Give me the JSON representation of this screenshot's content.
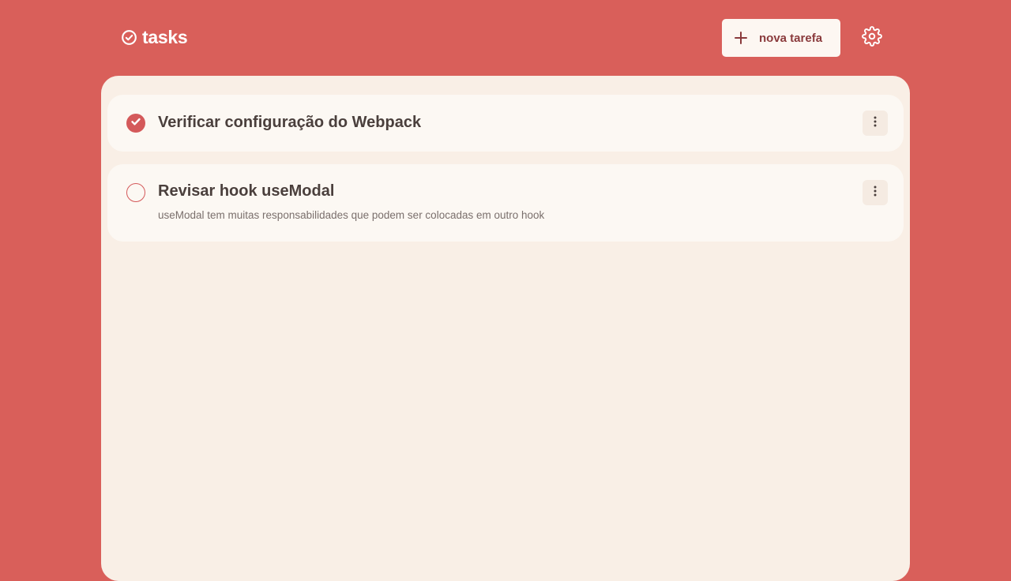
{
  "header": {
    "logo_text": "tasks",
    "new_task_label": "nova tarefa"
  },
  "colors": {
    "background": "#d95f5a",
    "panel": "#f9efe6",
    "card": "#fcf8f3",
    "accent": "#d4595a"
  },
  "tasks": [
    {
      "title": "Verificar configuração do Webpack",
      "description": "",
      "completed": true
    },
    {
      "title": "Revisar hook useModal",
      "description": "useModal tem muitas responsabilidades que podem ser colocadas em outro hook",
      "completed": false
    }
  ],
  "icons": {
    "logo": "check-circle-icon",
    "new_task": "plus-icon",
    "settings": "gear-icon",
    "task_menu": "vertical-dots-icon",
    "task_done": "check-icon"
  }
}
